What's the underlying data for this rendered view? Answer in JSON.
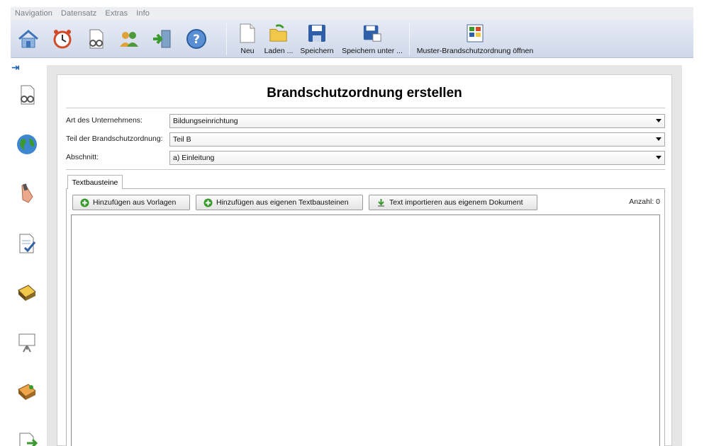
{
  "menu": {
    "items": [
      "Navigation",
      "Datensatz",
      "Extras",
      "Info"
    ]
  },
  "toolbar": {
    "nav_icons": [
      "home-icon",
      "alarm-clock-icon",
      "search-document-icon",
      "users-icon",
      "exit-door-icon",
      "help-icon"
    ],
    "buttons": [
      {
        "label": "Neu",
        "icon": "new-document-icon"
      },
      {
        "label": "Laden ...",
        "icon": "open-folder-icon"
      },
      {
        "label": "Speichern",
        "icon": "save-icon"
      },
      {
        "label": "Speichern unter ...",
        "icon": "save-as-icon"
      },
      {
        "label": "Muster-Brandschutzordnung öffnen",
        "icon": "template-icon"
      }
    ]
  },
  "sidebar": {
    "icons": [
      "search-document-icon",
      "globe-icon",
      "pen-hand-icon",
      "checklist-document-icon",
      "book-icon",
      "presentation-board-icon",
      "address-book-icon",
      "export-document-icon"
    ]
  },
  "main": {
    "title": "Brandschutzordnung erstellen",
    "fields": [
      {
        "label": "Art des Unternehmens:",
        "value": "Bildungseinrichtung"
      },
      {
        "label": "Teil der Brandschutzordnung:",
        "value": "Teil B"
      },
      {
        "label": "Abschnitt:",
        "value": "a) Einleitung"
      }
    ],
    "tab_label": "Textbausteine",
    "actions": {
      "add_templates": "Hinzufügen aus Vorlagen",
      "add_own": "Hinzufügen aus eigenen Textbausteinen",
      "import_doc": "Text importieren aus eigenem Dokument"
    },
    "count_label": "Anzahl: 0"
  },
  "colors": {
    "toolbar_top": "#e7ebf5",
    "toolbar_bottom": "#cfd8ea",
    "accent_blue": "#1d5fb4",
    "add_green": "#3a9a2e"
  }
}
